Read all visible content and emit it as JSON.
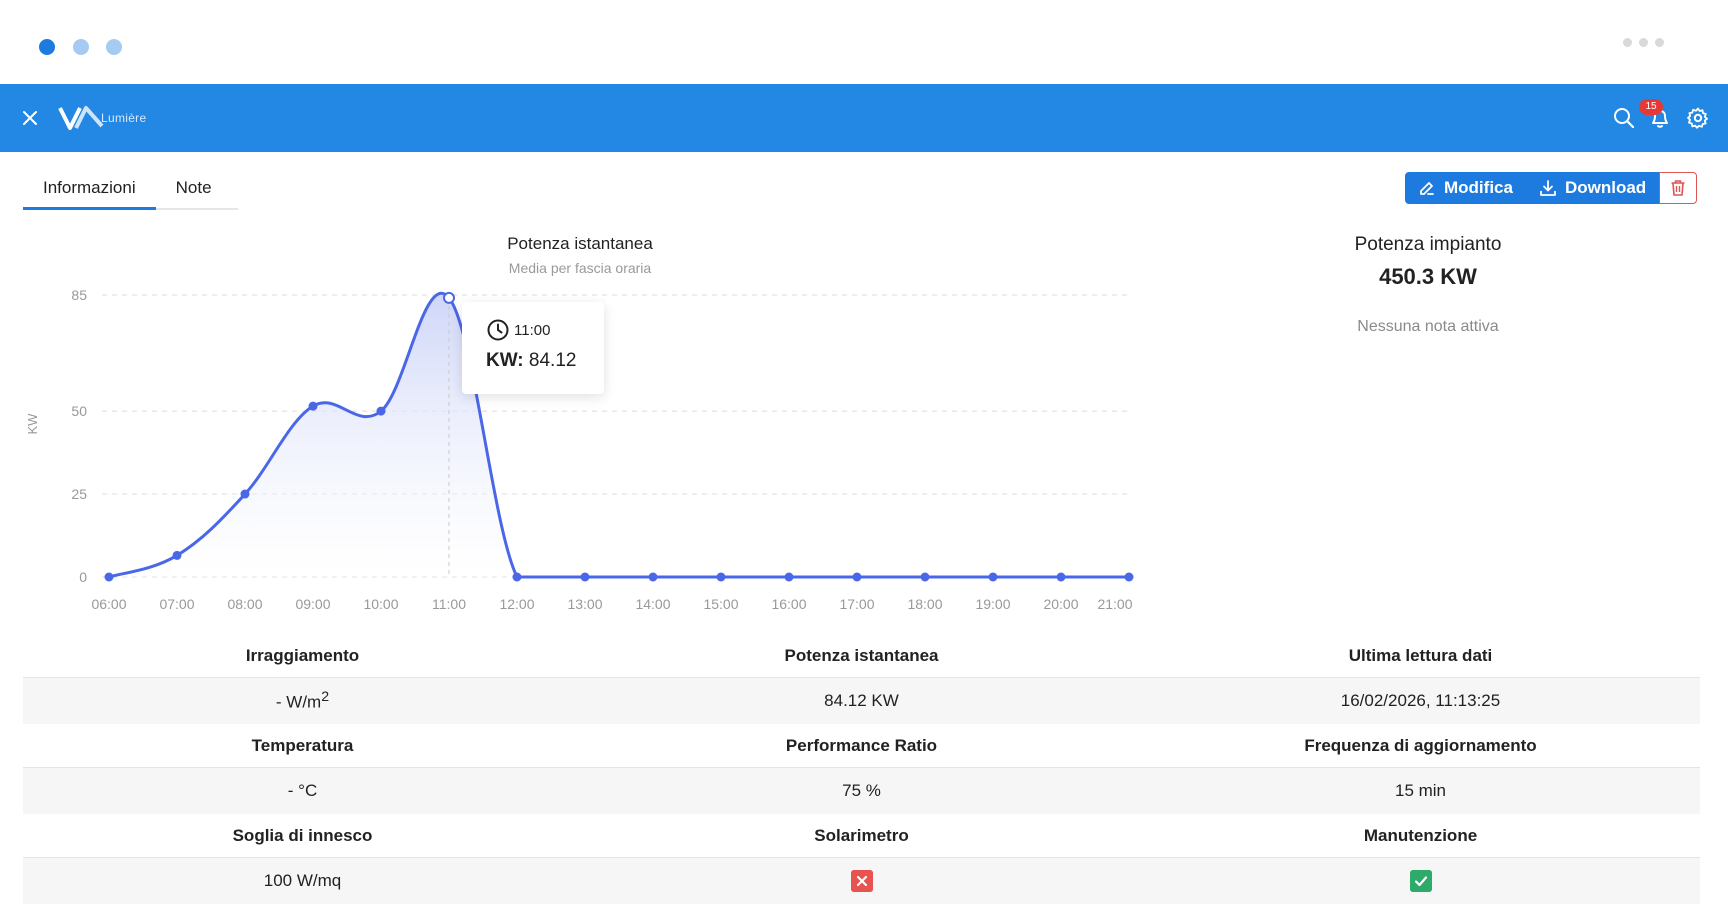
{
  "app": {
    "logo_text": "Lumière",
    "notifications_count": "15"
  },
  "tabs": [
    {
      "label": "Informazioni",
      "active": true
    },
    {
      "label": "Note",
      "active": false
    }
  ],
  "actions": {
    "edit_label": "Modifica",
    "download_label": "Download"
  },
  "chart_data": {
    "type": "area",
    "title": "Potenza istantanea",
    "subtitle": "Media per fascia oraria",
    "ylabel": "KW",
    "xlabel": "",
    "x": [
      "06:00",
      "07:00",
      "08:00",
      "09:00",
      "10:00",
      "11:00",
      "12:00",
      "13:00",
      "14:00",
      "15:00",
      "16:00",
      "17:00",
      "18:00",
      "19:00",
      "20:00",
      "21:00"
    ],
    "y_ticks": [
      0,
      25,
      50,
      85
    ],
    "ylim": [
      0,
      85
    ],
    "series": [
      {
        "values": [
          0,
          6.5,
          25,
          51.5,
          50,
          84.12,
          0,
          0,
          0,
          0,
          0,
          0,
          0,
          0,
          0,
          0
        ]
      }
    ],
    "grid": true,
    "tooltip": {
      "time": "11:00",
      "label": "KW:",
      "value": "84.12"
    },
    "colors": {
      "line": "#4a67e8",
      "fill_top": "#c9d1f7",
      "fill_bottom": "#ffffff"
    }
  },
  "summary": {
    "title": "Potenza impianto",
    "value": "450.3 KW",
    "note": "Nessuna nota attiva"
  },
  "info_rows": [
    {
      "headers": [
        "Irraggiamento",
        "Potenza istantanea",
        "Ultima lettura dati"
      ],
      "values": [
        "- W/m",
        "84.12 KW",
        "16/02/2026, 11:13:25"
      ],
      "unit_sup": "2"
    },
    {
      "headers": [
        "Temperatura",
        "Performance Ratio",
        "Frequenza di aggiornamento"
      ],
      "values": [
        "- °C",
        "75 %",
        "15 min"
      ]
    },
    {
      "headers": [
        "Soglia di innesco",
        "Solarimetro",
        "Manutenzione"
      ],
      "values": [
        "100 W/mq"
      ],
      "status": {
        "solarimetro": false,
        "manutenzione": true
      }
    }
  ],
  "colors": {
    "primary": "#2288e4",
    "danger": "#e8524f",
    "success": "#2eaa6a"
  }
}
